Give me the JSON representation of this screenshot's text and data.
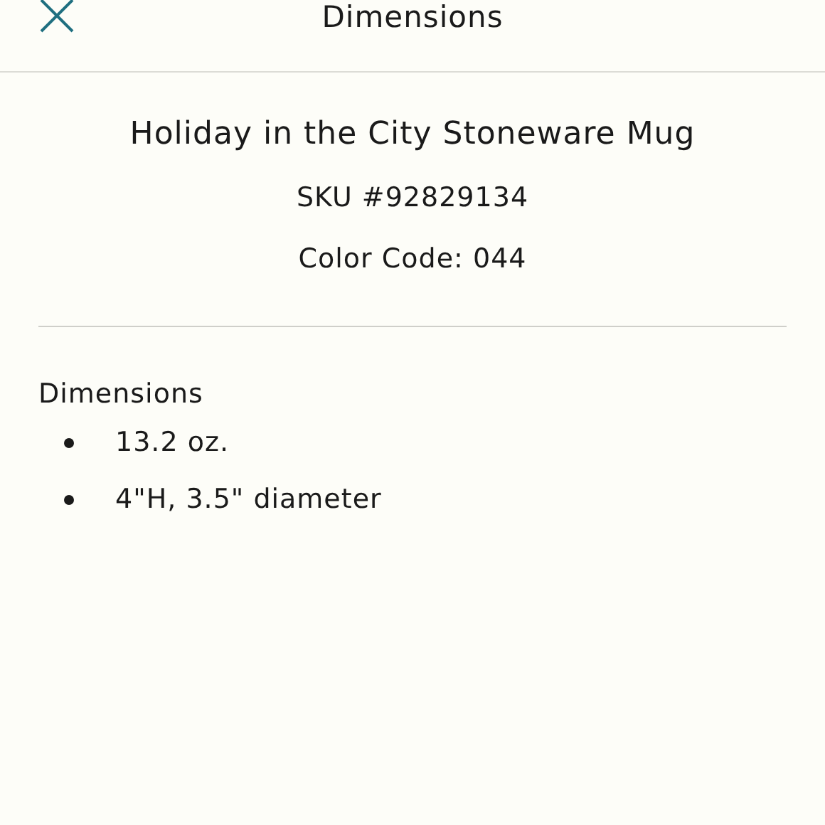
{
  "header": {
    "title": "Dimensions"
  },
  "product": {
    "name": "Holiday in the City Stoneware Mug",
    "sku": "SKU #92829134",
    "color_code": "Color Code: 044"
  },
  "section": {
    "heading": "Dimensions",
    "items": [
      "13.2 oz.",
      "4\"H, 3.5\" diameter"
    ]
  }
}
